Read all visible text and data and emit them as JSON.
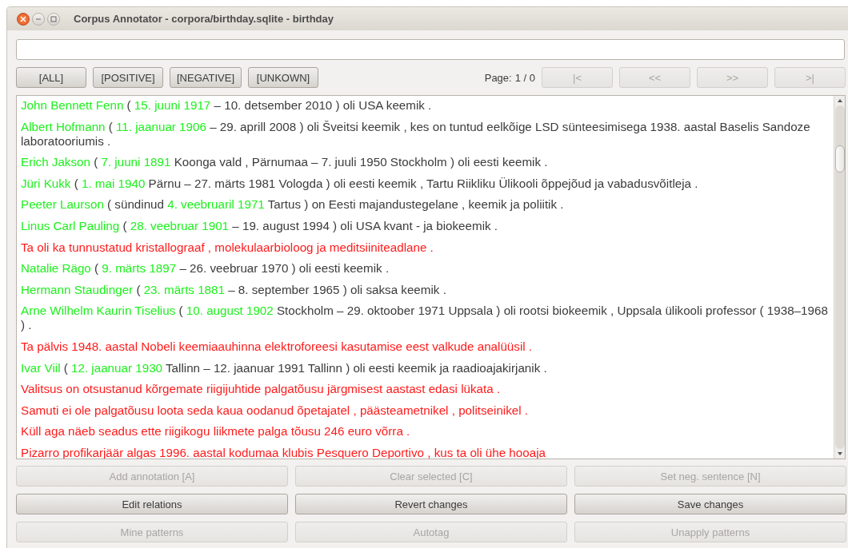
{
  "window": {
    "title": "Corpus Annotator - corpora/birthday.sqlite - birthday"
  },
  "filters": [
    {
      "label": "[ALL]",
      "disabled": false
    },
    {
      "label": "[POSITIVE]",
      "disabled": false
    },
    {
      "label": "[NEGATIVE]",
      "disabled": false
    },
    {
      "label": "[UNKOWN]",
      "disabled": false
    }
  ],
  "pager": {
    "label": "Page:",
    "value": "1 / 0",
    "buttons": [
      {
        "label": "|<",
        "disabled": true
      },
      {
        "label": "<<",
        "disabled": true
      },
      {
        "label": ">>",
        "disabled": true
      },
      {
        "label": ">|",
        "disabled": true
      }
    ]
  },
  "sentences": [
    {
      "kind": "positive",
      "parts": [
        {
          "text": "John Bennett Fenn",
          "highlight": true
        },
        {
          "text": " ( ",
          "highlight": false
        },
        {
          "text": "15. juuni 1917",
          "highlight": true
        },
        {
          "text": " – 10. detsember 2010 ) oli USA keemik .",
          "highlight": false
        }
      ]
    },
    {
      "kind": "positive",
      "parts": [
        {
          "text": "Albert Hofmann",
          "highlight": true
        },
        {
          "text": " ( ",
          "highlight": false
        },
        {
          "text": "11. jaanuar 1906",
          "highlight": true
        },
        {
          "text": " – 29. aprill 2008 ) oli Šveitsi keemik , kes on tuntud eelkõige LSD sünteesimisega 1938. aastal Baselis Sandoze laboratooriumis .",
          "highlight": false
        }
      ]
    },
    {
      "kind": "positive",
      "parts": [
        {
          "text": "Erich Jakson",
          "highlight": true
        },
        {
          "text": " ( ",
          "highlight": false
        },
        {
          "text": "7. juuni 1891",
          "highlight": true
        },
        {
          "text": " Koonga vald , Pärnumaa – 7. juuli 1950 Stockholm ) oli eesti keemik .",
          "highlight": false
        }
      ]
    },
    {
      "kind": "positive",
      "parts": [
        {
          "text": "Jüri Kukk",
          "highlight": true
        },
        {
          "text": " ( ",
          "highlight": false
        },
        {
          "text": "1. mai 1940",
          "highlight": true
        },
        {
          "text": " Pärnu – 27. märts 1981 Vologda ) oli eesti keemik , Tartu Riikliku Ülikooli õppejõud ja vabadusvõitleja .",
          "highlight": false
        }
      ]
    },
    {
      "kind": "positive",
      "parts": [
        {
          "text": "Peeter Laurson",
          "highlight": true
        },
        {
          "text": " ( sündinud ",
          "highlight": false
        },
        {
          "text": "4. veebruaril 1971",
          "highlight": true
        },
        {
          "text": " Tartus ) on Eesti majandustegelane , keemik ja poliitik .",
          "highlight": false
        }
      ]
    },
    {
      "kind": "positive",
      "parts": [
        {
          "text": "Linus Carl Pauling",
          "highlight": true
        },
        {
          "text": " ( ",
          "highlight": false
        },
        {
          "text": "28. veebruar 1901",
          "highlight": true
        },
        {
          "text": " – 19. august 1994 ) oli USA kvant - ja biokeemik .",
          "highlight": false
        }
      ]
    },
    {
      "kind": "negative",
      "parts": [
        {
          "text": "Ta oli ka tunnustatud kristallograaf , molekulaarbioloog ja meditsiiniteadlane .",
          "highlight": false
        }
      ]
    },
    {
      "kind": "positive",
      "parts": [
        {
          "text": "Natalie Rägo",
          "highlight": true
        },
        {
          "text": " ( ",
          "highlight": false
        },
        {
          "text": "9. märts 1897",
          "highlight": true
        },
        {
          "text": " – 26. veebruar 1970 ) oli eesti keemik .",
          "highlight": false
        }
      ]
    },
    {
      "kind": "positive",
      "parts": [
        {
          "text": "Hermann Staudinger",
          "highlight": true
        },
        {
          "text": " ( ",
          "highlight": false
        },
        {
          "text": "23. märts 1881",
          "highlight": true
        },
        {
          "text": " – 8. september 1965 ) oli saksa keemik .",
          "highlight": false
        }
      ]
    },
    {
      "kind": "positive",
      "parts": [
        {
          "text": "Arne Wilhelm Kaurin Tiselius",
          "highlight": true
        },
        {
          "text": " ( ",
          "highlight": false
        },
        {
          "text": "10. august 1902",
          "highlight": true
        },
        {
          "text": " Stockholm – 29. oktoober 1971 Uppsala ) oli rootsi biokeemik , Uppsala ülikooli professor ( 1938–1968 ) .",
          "highlight": false
        }
      ]
    },
    {
      "kind": "negative",
      "parts": [
        {
          "text": "Ta pälvis 1948. aastal Nobeli keemiaauhinna elektroforeesi kasutamise eest valkude analüüsil .",
          "highlight": false
        }
      ]
    },
    {
      "kind": "positive",
      "parts": [
        {
          "text": "Ivar Viil",
          "highlight": true
        },
        {
          "text": " ( ",
          "highlight": false
        },
        {
          "text": "12. jaanuar 1930",
          "highlight": true
        },
        {
          "text": " Tallinn – 12. jaanuar 1991 Tallinn ) oli eesti keemik ja raadioajakirjanik .",
          "highlight": false
        }
      ]
    },
    {
      "kind": "negative",
      "parts": [
        {
          "text": "Valitsus on otsustanud kõrgemate riigijuhtide palgatõusu järgmisest aastast edasi lükata .",
          "highlight": false
        }
      ]
    },
    {
      "kind": "negative",
      "parts": [
        {
          "text": "Samuti ei ole palgatõusu loota seda kaua oodanud õpetajatel , päästeametnikel , politseinikel .",
          "highlight": false
        }
      ]
    },
    {
      "kind": "negative",
      "parts": [
        {
          "text": "Küll aga näeb seadus ette riigikogu liikmete palga tõusu 246 euro võrra .",
          "highlight": false
        }
      ]
    },
    {
      "kind": "negative",
      "parts": [
        {
          "text": "Pizarro profikarjäär algas 1996. aastal kodumaa klubis Pesquero Deportivo , kus ta oli ühe hooaja",
          "highlight": false
        }
      ]
    }
  ],
  "actions": [
    [
      {
        "label": "Add annotation [A]",
        "disabled": true
      },
      {
        "label": "Clear selected [C]",
        "disabled": true
      },
      {
        "label": "Set neg. sentence [N]",
        "disabled": true
      }
    ],
    [
      {
        "label": "Edit relations",
        "disabled": false
      },
      {
        "label": "Revert changes",
        "disabled": false
      },
      {
        "label": "Save changes",
        "disabled": false
      }
    ],
    [
      {
        "label": "Mine patterns",
        "disabled": true
      },
      {
        "label": "Autotag",
        "disabled": true
      },
      {
        "label": "Unapply patterns",
        "disabled": true
      }
    ]
  ]
}
